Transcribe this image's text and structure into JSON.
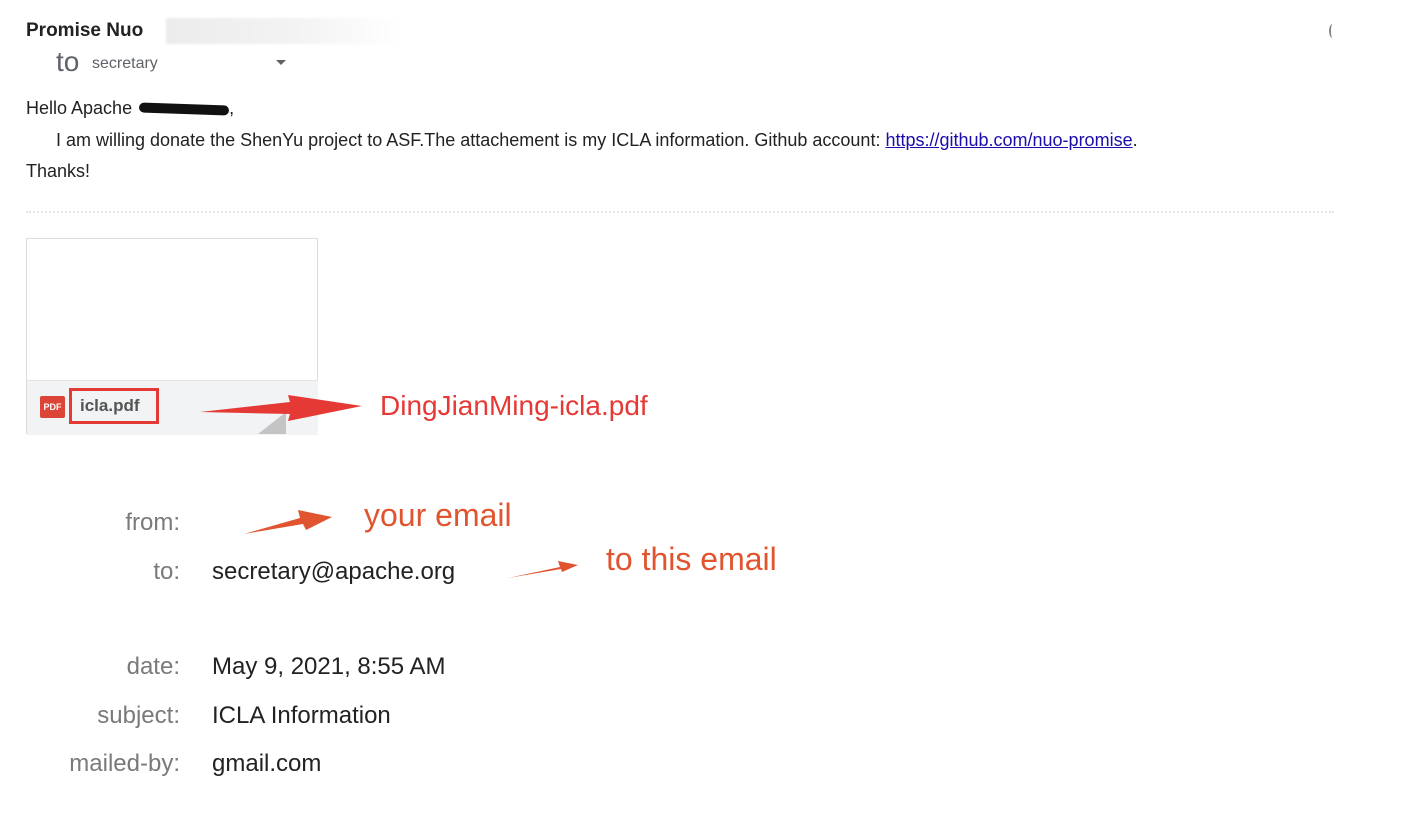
{
  "header": {
    "sender_name": "Promise Nuo",
    "to_label": "to",
    "to_value": "secretary"
  },
  "body": {
    "greeting_prefix": "Hello Apache",
    "greeting_suffix": ",",
    "message_text": "I am willing donate the ShenYu project to ASF.The attachement is my ICLA information. Github account: ",
    "github_link": "https://github.com/nuo-promise",
    "message_end": ".",
    "closing": "Thanks!"
  },
  "attachment": {
    "icon_label": "PDF",
    "file_name": "icla.pdf"
  },
  "annotations": {
    "pdf_rename": "DingJianMing-icla.pdf",
    "from_note": "your email",
    "to_note": "to this email",
    "colors": {
      "red": "#e53935",
      "orange": "#e0542f"
    }
  },
  "details": {
    "from_label": "from:",
    "to_label": "to:",
    "to_value": "secretary@apache.org",
    "date_label": "date:",
    "date_value": "May 9, 2021, 8:55 AM",
    "subject_label": "subject:",
    "subject_value": "ICLA Information",
    "mailed_by_label": "mailed-by:",
    "mailed_by_value": "gmail.com"
  }
}
